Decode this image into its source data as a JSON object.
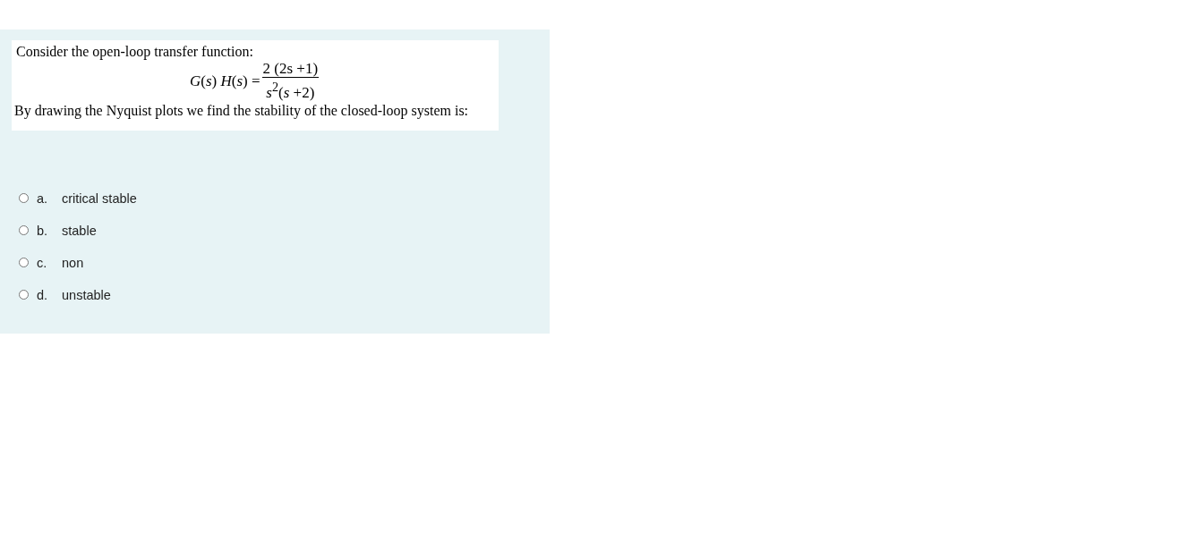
{
  "question": {
    "intro": "Consider the open-loop transfer function:",
    "formula": {
      "lhs": "*G*(*s*) *H*(*s*) =",
      "numerator": "2 (2s +1)",
      "denominator": "*s*$^{2}$(*s* +2)"
    },
    "prompt": "By drawing the Nyquist plots we find the stability of the closed-loop system is:"
  },
  "options": [
    {
      "letter": "a.",
      "label": "critical stable",
      "selected": false
    },
    {
      "letter": "b.",
      "label": "stable",
      "selected": false
    },
    {
      "letter": "c.",
      "label": "non",
      "selected": false
    },
    {
      "letter": "d.",
      "label": "unstable",
      "selected": false
    }
  ]
}
